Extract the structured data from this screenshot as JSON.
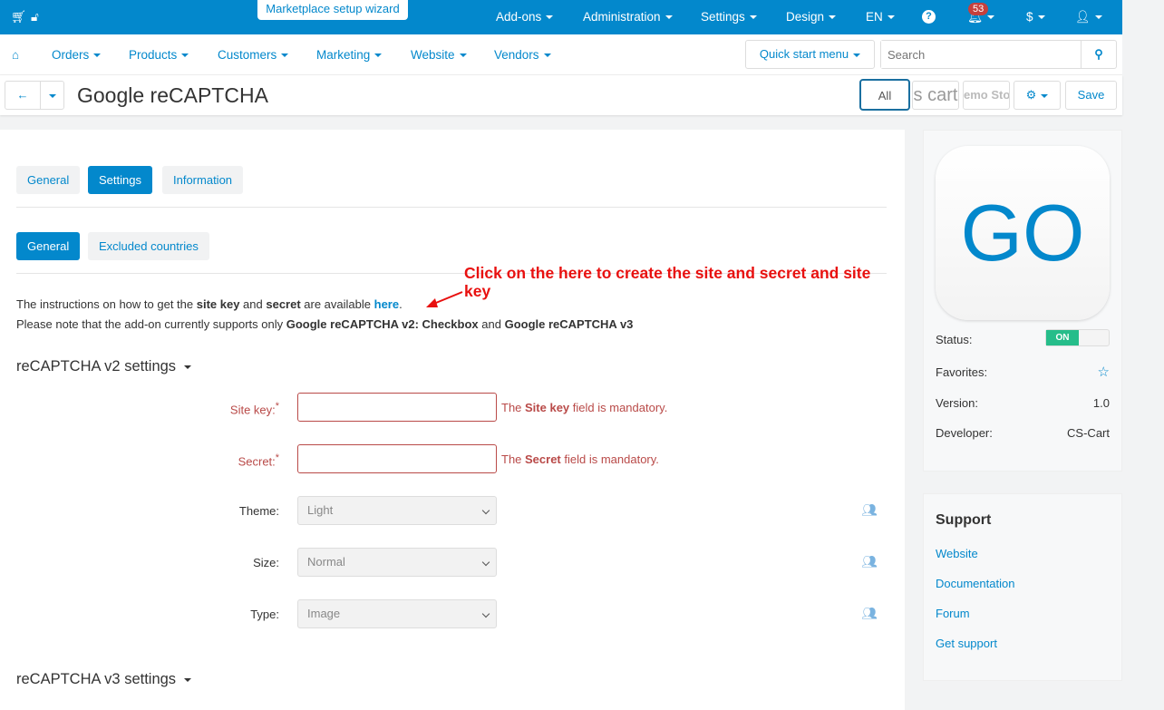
{
  "topbar": {
    "wizard": "Marketplace setup wizard",
    "menus": [
      "Add-ons",
      "Administration",
      "Settings",
      "Design",
      "EN"
    ],
    "notifications": "53",
    "currency": "$"
  },
  "nav": {
    "items": [
      "Orders",
      "Products",
      "Customers",
      "Marketing",
      "Website",
      "Vendors"
    ],
    "quick_start": "Quick start menu",
    "search_placeholder": "Search"
  },
  "header": {
    "title": "Google reCAPTCHA",
    "all": "All",
    "store1": "s cart",
    "store2": "emo Sto",
    "save": "Save"
  },
  "tabs": [
    "General",
    "Settings",
    "Information"
  ],
  "subtabs": [
    "General",
    "Excluded countries"
  ],
  "annotation": "Click on the here to create the site and secret and site key",
  "info": {
    "p1a": "The instructions on how to get the ",
    "site_key": "site key",
    "and": " and ",
    "secret": "secret",
    "p1b": " are available ",
    "here": "here",
    "dot": ".",
    "p2a": "Please note that the add-on currently supports only ",
    "v2": "Google reCAPTCHA v2: Checkbox",
    "and2": " and ",
    "v3": "Google reCAPTCHA v3"
  },
  "v2": {
    "heading": "reCAPTCHA v2 settings",
    "site_key_label": "Site key:",
    "secret_label": "Secret:",
    "site_err": [
      "The ",
      "Site key",
      " field is mandatory."
    ],
    "secret_err": [
      "The ",
      "Secret",
      " field is mandatory."
    ],
    "theme_label": "Theme:",
    "theme": "Light",
    "size_label": "Size:",
    "size": "Normal",
    "type_label": "Type:",
    "type": "Image"
  },
  "v3": {
    "heading": "reCAPTCHA v3 settings"
  },
  "addon": {
    "logo": "GO",
    "status_label": "Status:",
    "status": "ON",
    "favorites_label": "Favorites:",
    "version_label": "Version:",
    "version": "1.0",
    "developer_label": "Developer:",
    "developer": "CS-Cart"
  },
  "support": {
    "title": "Support",
    "links": [
      "Website",
      "Documentation",
      "Forum",
      "Get support"
    ]
  },
  "colors": {
    "brand": "#0388cc",
    "error": "#b94a48",
    "annotation": "#e8100f",
    "on": "#26bd8a"
  }
}
